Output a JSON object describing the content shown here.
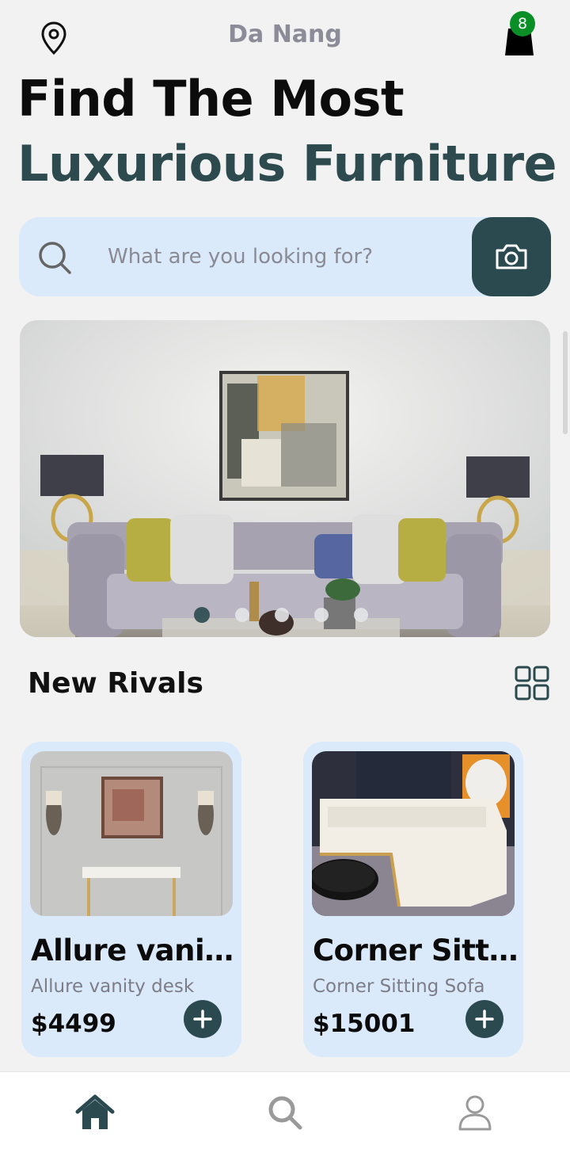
{
  "header": {
    "location_icon": "map-pin-icon",
    "city": "Da Nang",
    "cart_icon": "shopping-bag-icon",
    "cart_count": "8"
  },
  "hero": {
    "line1": "Find The Most",
    "line2": "Luxurious Furniture"
  },
  "search": {
    "placeholder": "What are you looking for?",
    "value": "",
    "icon": "search-icon",
    "camera_icon": "camera-icon"
  },
  "banner": {
    "slides_total": 5,
    "active_index": 0
  },
  "section": {
    "title": "New Rivals",
    "view_icon": "grid-view-icon"
  },
  "products": [
    {
      "title": "Allure vanity desk",
      "subtitle": "Allure vanity desk",
      "price": "$4499"
    },
    {
      "title": "Corner Sitting Sofa",
      "subtitle": "Corner Sitting Sofa",
      "price": "$15001"
    }
  ],
  "nav": [
    {
      "icon": "home-icon",
      "active": true
    },
    {
      "icon": "search-icon",
      "active": false
    },
    {
      "icon": "profile-icon",
      "active": false
    }
  ],
  "colors": {
    "accent": "#2b4a4f",
    "badge": "#0a8f26",
    "card_bg": "#dbeafb",
    "page_bg": "#f2f2f2",
    "muted_text": "#8c8c99"
  }
}
